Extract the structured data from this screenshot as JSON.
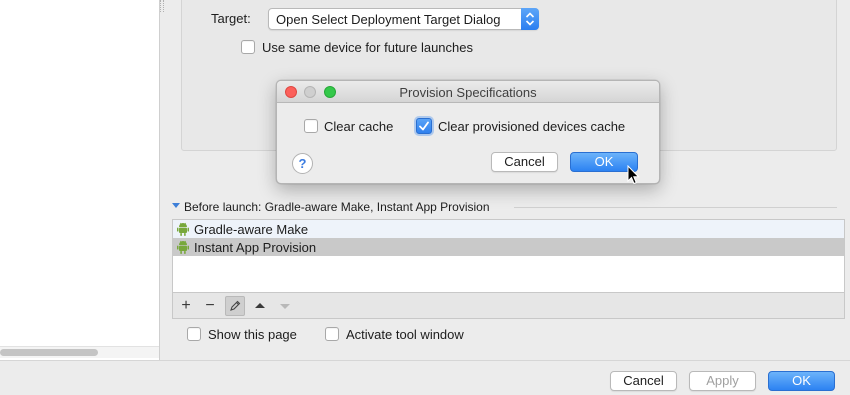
{
  "colors": {
    "accent": "#2c82f2",
    "window_bg": "#ececec"
  },
  "run_config": {
    "target_label": "Target:",
    "target_value": "Open Select Deployment Target Dialog",
    "use_same_device_label": "Use same device for future launches",
    "use_same_device_checked": false
  },
  "dialog": {
    "title": "Provision Specifications",
    "clear_cache_label": "Clear cache",
    "clear_cache_checked": false,
    "clear_provisioned_label": "Clear provisioned devices cache",
    "clear_provisioned_checked": true,
    "help_glyph": "?",
    "cancel_label": "Cancel",
    "ok_label": "OK"
  },
  "before_launch": {
    "header": "Before launch: Gradle-aware Make, Instant App Provision",
    "tasks": [
      {
        "label": "Gradle-aware Make",
        "icon": "android-icon",
        "selected": false
      },
      {
        "label": "Instant App Provision",
        "icon": "android-icon",
        "selected": true
      }
    ],
    "toolbar": {
      "add": "+",
      "remove": "−",
      "edit_icon": "pencil-icon",
      "up_icon": "arrow-up-icon",
      "down_icon": "arrow-down-icon"
    }
  },
  "options": {
    "show_page_label": "Show this page",
    "activate_tool_window_label": "Activate tool window"
  },
  "footer": {
    "cancel_label": "Cancel",
    "apply_label": "Apply",
    "ok_label": "OK"
  }
}
